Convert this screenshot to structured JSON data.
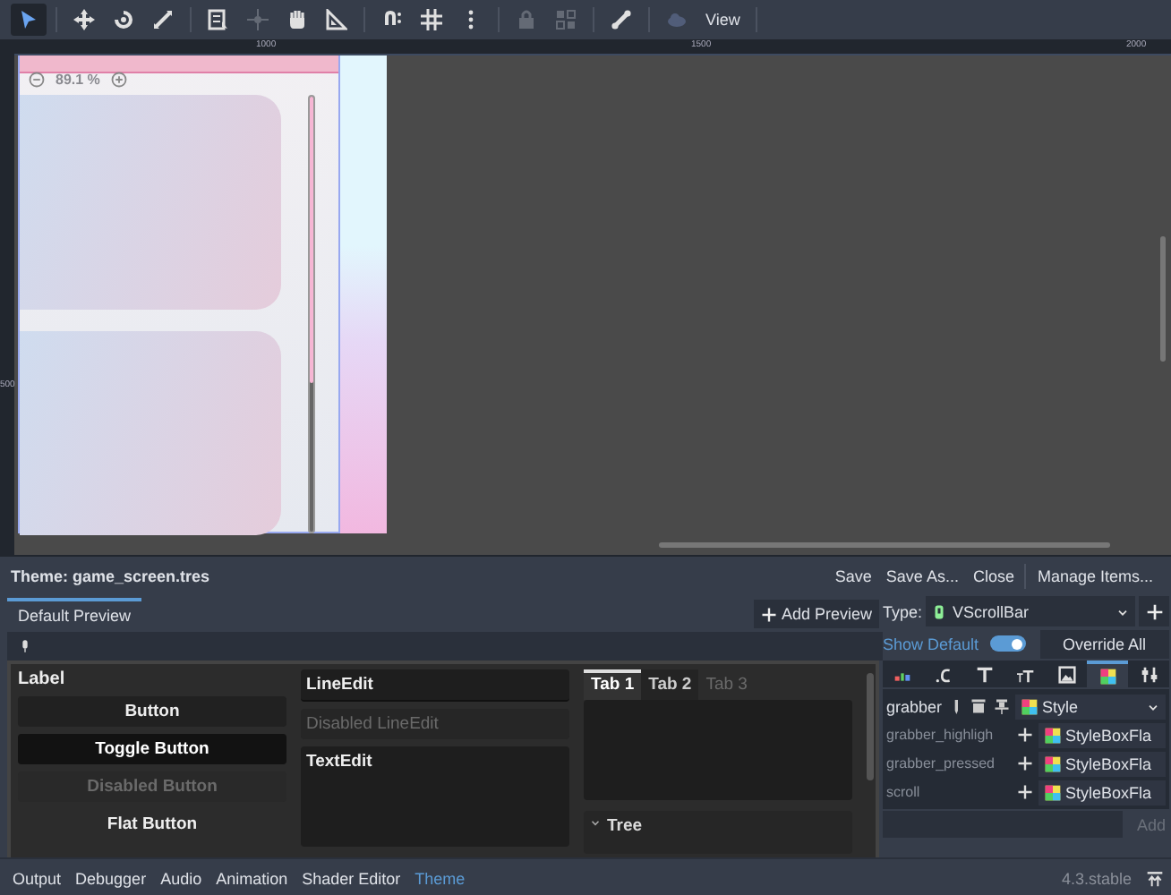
{
  "toolbar": {
    "tools": [
      {
        "kind": "select",
        "selected": true,
        "disabled": false
      },
      {
        "kind": "move",
        "selected": false,
        "disabled": false
      },
      {
        "kind": "rotate",
        "selected": false,
        "disabled": false
      },
      {
        "kind": "scale",
        "selected": false,
        "disabled": false
      },
      {
        "kind": "list",
        "selected": false,
        "disabled": false
      },
      {
        "kind": "pivot",
        "selected": false,
        "disabled": true
      },
      {
        "kind": "pan",
        "selected": false,
        "disabled": false
      },
      {
        "kind": "ruler",
        "selected": false,
        "disabled": false
      },
      {
        "kind": "snap",
        "selected": false,
        "disabled": false
      },
      {
        "kind": "grid",
        "selected": false,
        "disabled": false
      },
      {
        "kind": "more",
        "selected": false,
        "disabled": false
      },
      {
        "kind": "lock",
        "selected": false,
        "disabled": true
      },
      {
        "kind": "group",
        "selected": false,
        "disabled": true
      },
      {
        "kind": "bone",
        "selected": false,
        "disabled": false
      },
      {
        "kind": "cloud",
        "selected": false,
        "disabled": true
      }
    ],
    "view_menu": "View"
  },
  "viewport": {
    "ruler_labels": [
      "1000",
      "1500",
      "2000"
    ],
    "vertical_ruler_label": "500",
    "zoom": "89.1 %"
  },
  "theme_panel": {
    "title": "Theme: game_screen.tres",
    "actions": [
      "Save",
      "Save As...",
      "Close",
      "Manage Items..."
    ],
    "preview_tabs": [
      {
        "label": "Default Preview",
        "selected": true
      }
    ],
    "add_preview": "Add Preview",
    "preview": {
      "label": "Label",
      "buttons": [
        {
          "label": "Button",
          "kind": "normal"
        },
        {
          "label": "Toggle Button",
          "kind": "pressed"
        },
        {
          "label": "Disabled Button",
          "kind": "disabled"
        },
        {
          "label": "Flat Button",
          "kind": "flat"
        }
      ],
      "line_edits": [
        {
          "value": "LineEdit",
          "disabled": false
        },
        {
          "value": "Disabled LineEdit",
          "disabled": true
        }
      ],
      "text_edit": "TextEdit",
      "tabs": [
        {
          "label": "Tab 1",
          "selected": true,
          "disabled": false
        },
        {
          "label": "Tab 2",
          "selected": false,
          "disabled": false
        },
        {
          "label": "Tab 3",
          "selected": false,
          "disabled": true
        }
      ],
      "tree": "Tree"
    },
    "editor": {
      "type_label": "Type:",
      "type_value": "VScrollBar",
      "show_default": {
        "label": "Show Default",
        "on": true
      },
      "override_all": "Override All",
      "data_tabs": [
        {
          "kind": "color",
          "selected": false
        },
        {
          "kind": "constant",
          "selected": false
        },
        {
          "kind": "font",
          "selected": false
        },
        {
          "kind": "font_size",
          "selected": false
        },
        {
          "kind": "icon",
          "selected": false
        },
        {
          "kind": "stylebox",
          "selected": true
        },
        {
          "kind": "type",
          "selected": false
        }
      ],
      "items": [
        {
          "name": "grabber",
          "kind": "overridden",
          "value": "Style"
        },
        {
          "name": "grabber_highligh",
          "kind": "default",
          "value": "StyleBoxFla"
        },
        {
          "name": "grabber_pressed",
          "kind": "default",
          "value": "StyleBoxFla"
        },
        {
          "name": "scroll",
          "kind": "default",
          "value": "StyleBoxFla"
        }
      ],
      "add_button": {
        "label": "Add",
        "disabled": true
      }
    }
  },
  "bottom_tabs": [
    {
      "label": "Output",
      "selected": false
    },
    {
      "label": "Debugger",
      "selected": false
    },
    {
      "label": "Audio",
      "selected": false
    },
    {
      "label": "Animation",
      "selected": false
    },
    {
      "label": "Shader Editor",
      "selected": false
    },
    {
      "label": "Theme",
      "selected": true
    }
  ],
  "version": "4.3.stable"
}
